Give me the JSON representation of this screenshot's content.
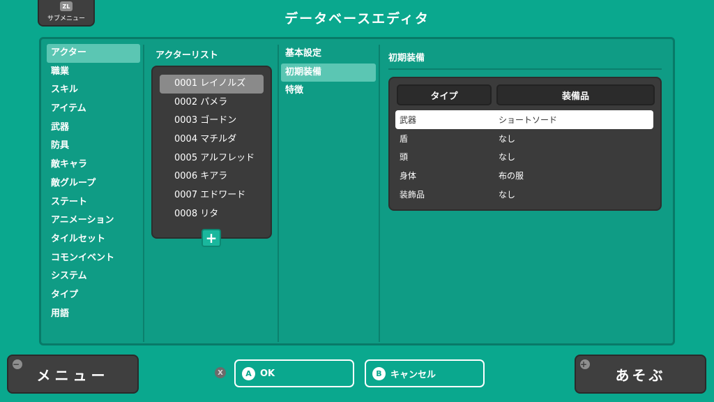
{
  "header": {
    "submenu_key": "ZL",
    "submenu_label": "サブメニュー",
    "title": "データベースエディタ"
  },
  "categories": [
    {
      "label": "アクター",
      "selected": true
    },
    {
      "label": "職業"
    },
    {
      "label": "スキル"
    },
    {
      "label": "アイテム"
    },
    {
      "label": "武器"
    },
    {
      "label": "防具"
    },
    {
      "label": "敵キャラ"
    },
    {
      "label": "敵グループ"
    },
    {
      "label": "ステート"
    },
    {
      "label": "アニメーション"
    },
    {
      "label": "タイルセット"
    },
    {
      "label": "コモンイベント"
    },
    {
      "label": "システム"
    },
    {
      "label": "タイプ"
    },
    {
      "label": "用語"
    }
  ],
  "actors": {
    "header": "アクターリスト",
    "items": [
      {
        "label": "0001 レイノルズ",
        "selected": true
      },
      {
        "label": "0002 パメラ"
      },
      {
        "label": "0003 ゴードン"
      },
      {
        "label": "0004 マチルダ"
      },
      {
        "label": "0005 アルフレッド"
      },
      {
        "label": "0006 キアラ"
      },
      {
        "label": "0007 エドワード"
      },
      {
        "label": "0008 リタ"
      }
    ],
    "add_icon": "+"
  },
  "settings": [
    {
      "label": "基本設定"
    },
    {
      "label": "初期装備",
      "selected": true
    },
    {
      "label": "特徴"
    }
  ],
  "detail": {
    "title": "初期装備",
    "col_type": "タイプ",
    "col_item": "装備品",
    "rows": [
      {
        "type": "武器",
        "item": "ショートソード",
        "selected": true
      },
      {
        "type": "盾",
        "item": "なし"
      },
      {
        "type": "頭",
        "item": "なし"
      },
      {
        "type": "身体",
        "item": "布の服"
      },
      {
        "type": "装飾品",
        "item": "なし"
      }
    ]
  },
  "footer": {
    "menu_icon": "−",
    "menu_label": "メニュー",
    "x_key": "X",
    "ok_key": "A",
    "ok_label": "OK",
    "cancel_key": "B",
    "cancel_label": "キャンセル",
    "play_icon": "+",
    "play_label": "あそぶ"
  },
  "colors": {
    "background": "#0aa88e",
    "panel": "#0f9c85",
    "selected_row": "#5bc6b3",
    "dark_box": "#3b3b3b"
  }
}
